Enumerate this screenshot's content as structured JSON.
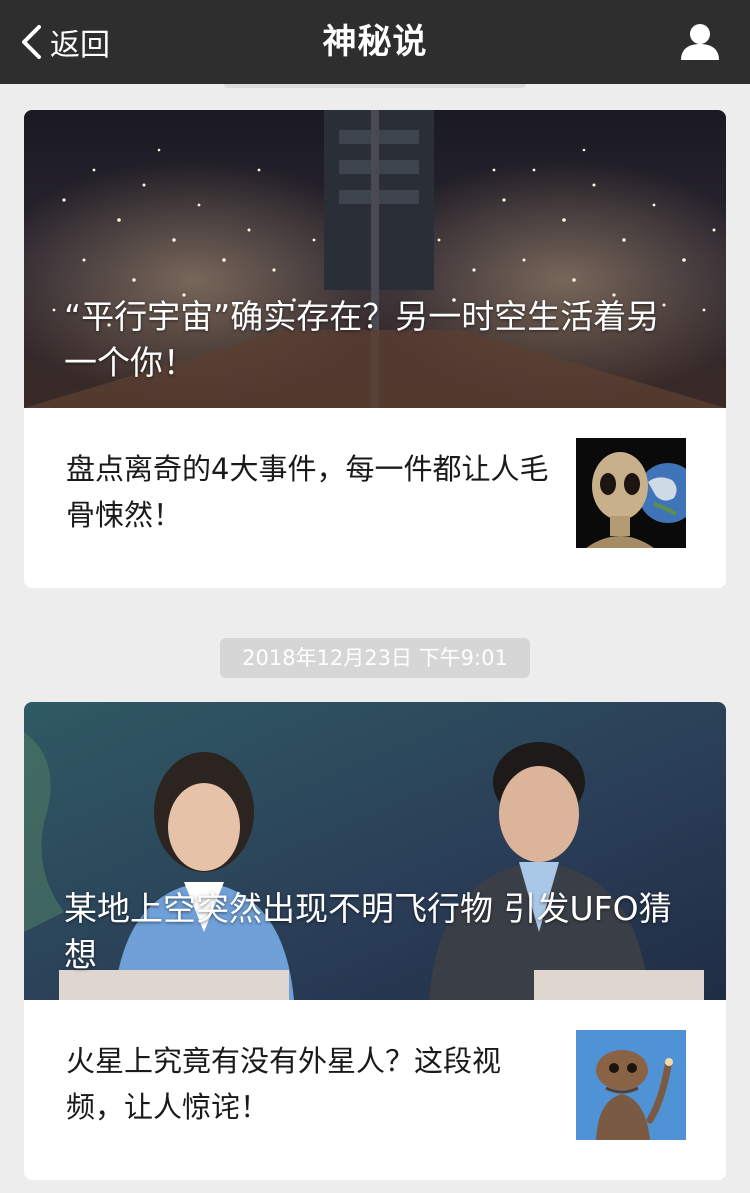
{
  "nav": {
    "back_label": "返回",
    "title": "神秘说"
  },
  "articles": [
    {
      "cover_title": "“平行宇宙”确实存在？另一时空生活着另一个你！",
      "sub_title": "盘点离奇的4大事件，每一件都让人毛骨悚然！"
    },
    {
      "cover_title": "某地上空突然出现不明飞行物 引发UFO猜想",
      "sub_title": "火星上究竟有没有外星人？这段视频，让人惊诧！"
    }
  ],
  "timestamp": "2018年12月23日 下午9:01"
}
